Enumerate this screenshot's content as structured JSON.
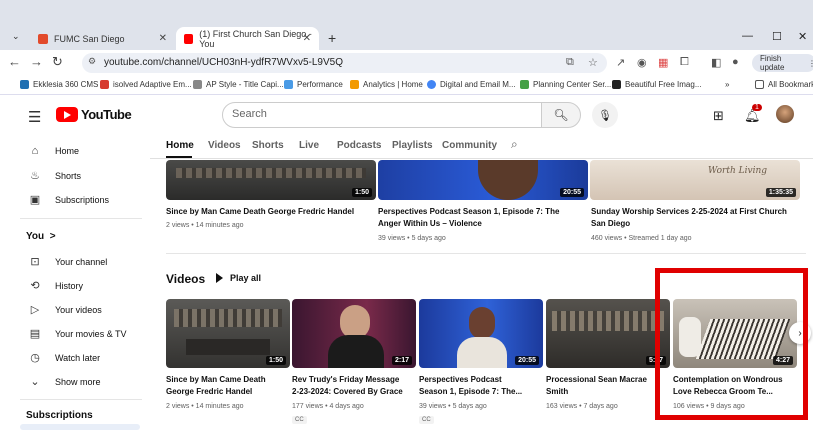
{
  "browser": {
    "tabs": [
      {
        "title": "FUMC San Diego",
        "active": false,
        "favicon_color": "#e24a2b"
      },
      {
        "title": "(1) First Church San Diego - You",
        "active": true,
        "favicon_color": "#ff0000"
      }
    ],
    "url": "youtube.com/channel/UCH03nH-ydfR7WVxv5-L9V5Q",
    "finish_update": "Finish update",
    "bookmarks": [
      {
        "label": "Ekklesia 360 CMS",
        "color": "#1f6fb2"
      },
      {
        "label": "isolved Adaptive Em...",
        "color": "#d63b2f"
      },
      {
        "label": "AP Style - Title Capi...",
        "color": "#888888"
      },
      {
        "label": "Performance",
        "color": "#4a9be6"
      },
      {
        "label": "Analytics | Home",
        "color": "#f29900"
      },
      {
        "label": "Digital and Email M...",
        "color": "#4285f4"
      },
      {
        "label": "Planning Center Ser...",
        "color": "#45a046"
      },
      {
        "label": "Beautiful Free Imag...",
        "color": "#222222"
      }
    ],
    "all_bookmarks": "All Bookmarks"
  },
  "youtube": {
    "logo_text": "YouTube",
    "search_placeholder": "Search",
    "sidebar": {
      "main": [
        {
          "label": "Home",
          "icon": "home-icon"
        },
        {
          "label": "Shorts",
          "icon": "shorts-icon"
        },
        {
          "label": "Subscriptions",
          "icon": "subscriptions-icon"
        }
      ],
      "you_heading": "You",
      "you": [
        {
          "label": "Your channel",
          "icon": "channel-icon"
        },
        {
          "label": "History",
          "icon": "history-icon"
        },
        {
          "label": "Your videos",
          "icon": "videos-icon"
        },
        {
          "label": "Your movies & TV",
          "icon": "movies-icon"
        },
        {
          "label": "Watch later",
          "icon": "clock-icon"
        },
        {
          "label": "Show more",
          "icon": "chevron-down-icon"
        }
      ],
      "subscriptions_heading": "Subscriptions"
    },
    "channel_tabs": [
      "Home",
      "Videos",
      "Shorts",
      "Live",
      "Podcasts",
      "Playlists",
      "Community"
    ],
    "featured": [
      {
        "title": "Since by Man Came Death George Fredric Handel",
        "meta": "2 views • 14 minutes ago",
        "duration": "1:50"
      },
      {
        "title": "Perspectives Podcast Season 1, Episode 7: The Anger Within Us – Violence",
        "meta": "39 views • 5 days ago",
        "duration": "20:55"
      },
      {
        "title": "Sunday Worship Services 2-25-2024 at First Church San Diego",
        "meta": "460 views • Streamed 1 day ago",
        "duration": "1:35:35",
        "thumb_caption": "Worth Living"
      }
    ],
    "videos_section": {
      "title": "Videos",
      "play_all": "Play all"
    },
    "videos": [
      {
        "title_1": "Since by Man Came Death",
        "title_2": "George Fredric Handel",
        "meta": "2 views • 14 minutes ago",
        "duration": "1:50",
        "cc": ""
      },
      {
        "title_1": "Rev Trudy's Friday Message",
        "title_2": "2-23-2024: Covered By Grace",
        "meta": "177 views • 4 days ago",
        "duration": "2:17",
        "cc": "CC"
      },
      {
        "title_1": "Perspectives Podcast",
        "title_2": "Season 1, Episode 7: The...",
        "meta": "39 views • 5 days ago",
        "duration": "20:55",
        "cc": "CC"
      },
      {
        "title_1": "Processional Sean Macrae",
        "title_2": "Smith",
        "meta": "163 views • 7 days ago",
        "duration": "5:07",
        "cc": ""
      },
      {
        "title_1": "Contemplation on Wondrous",
        "title_2": "Love Rebecca Groom Te...",
        "meta": "106 views • 9 days ago",
        "duration": "4:27",
        "cc": ""
      }
    ],
    "notifications_badge": "1"
  }
}
